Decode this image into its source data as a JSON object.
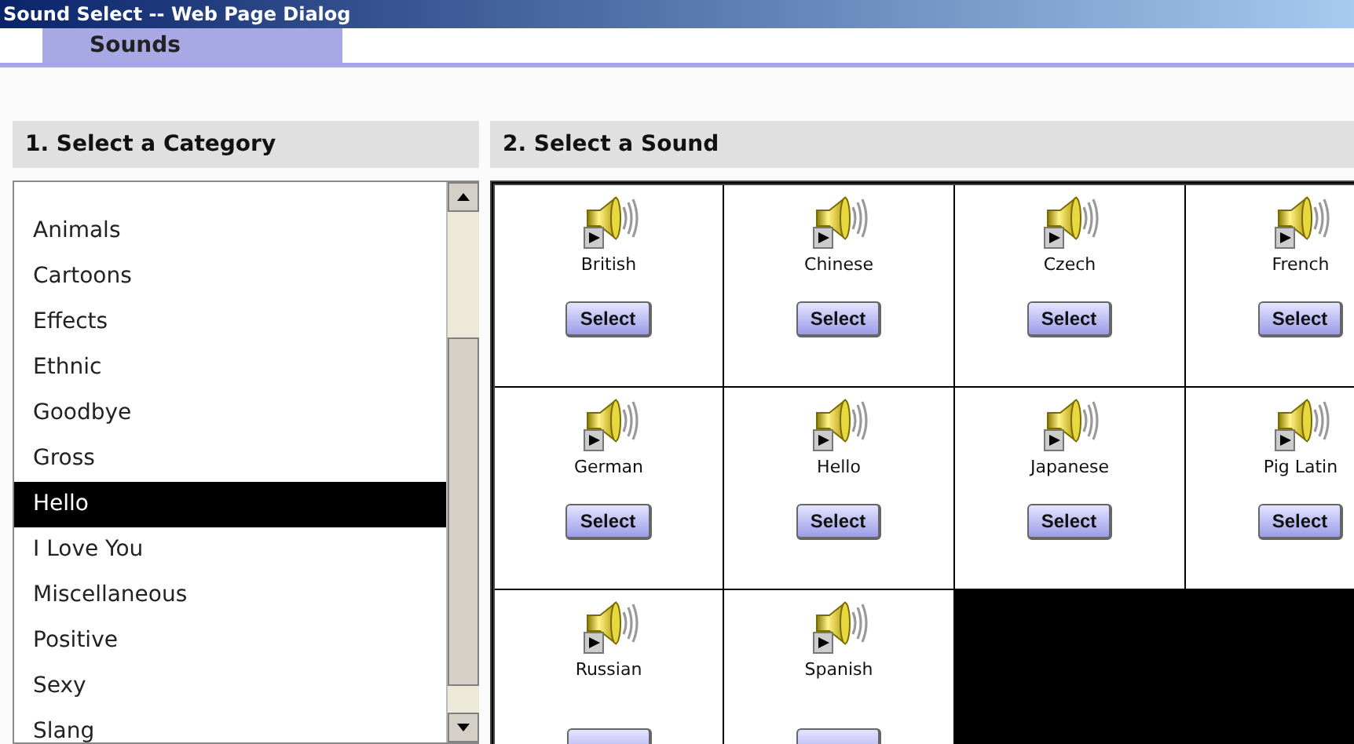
{
  "window": {
    "title": "Sound Select -- Web Page Dialog"
  },
  "tabs": [
    {
      "label": "Sounds",
      "selected": true
    }
  ],
  "category_panel": {
    "heading": "1. Select a Category",
    "items": [
      {
        "label": "Animals",
        "selected": false
      },
      {
        "label": "Cartoons",
        "selected": false
      },
      {
        "label": "Effects",
        "selected": false
      },
      {
        "label": "Ethnic",
        "selected": false
      },
      {
        "label": "Goodbye",
        "selected": false
      },
      {
        "label": "Gross",
        "selected": false
      },
      {
        "label": "Hello",
        "selected": true
      },
      {
        "label": "I Love You",
        "selected": false
      },
      {
        "label": "Miscellaneous",
        "selected": false
      },
      {
        "label": "Positive",
        "selected": false
      },
      {
        "label": "Sexy",
        "selected": false
      },
      {
        "label": "Slang",
        "selected": false
      }
    ]
  },
  "sound_panel": {
    "heading": "2. Select a Sound",
    "sounds": [
      {
        "name": "British",
        "kind": "full",
        "button": "Select"
      },
      {
        "name": "Chinese",
        "kind": "full",
        "button": "Select"
      },
      {
        "name": "Czech",
        "kind": "full",
        "button": "Select"
      },
      {
        "name": "French",
        "kind": "full",
        "button": "Select"
      },
      {
        "name": "German",
        "kind": "full",
        "button": "Select"
      },
      {
        "name": "Hello",
        "kind": "full",
        "button": "Select"
      },
      {
        "name": "Japanese",
        "kind": "full",
        "button": "Select"
      },
      {
        "name": "Pig Latin",
        "kind": "full",
        "button": "Select"
      },
      {
        "name": "Russian",
        "kind": "cut"
      },
      {
        "name": "Spanish",
        "kind": "cut"
      }
    ]
  }
}
